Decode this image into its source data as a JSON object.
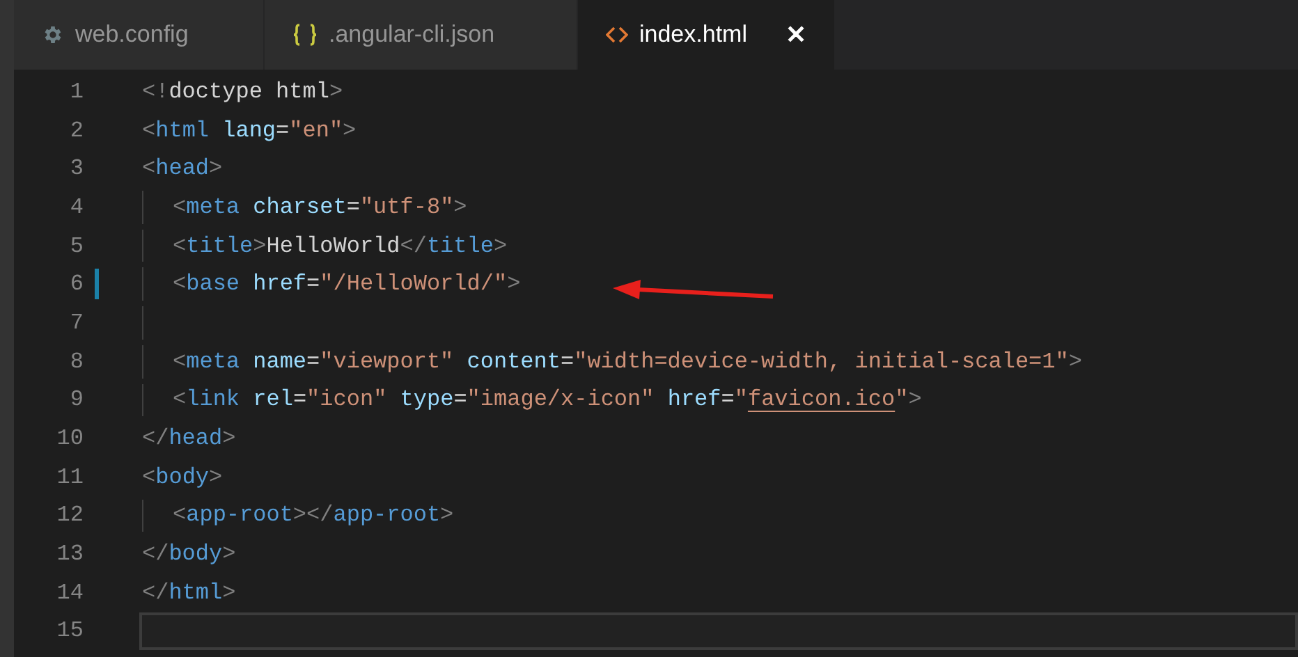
{
  "tabs": [
    {
      "label": "web.config",
      "selected": false
    },
    {
      "label": ".angular-cli.json",
      "selected": false
    },
    {
      "label": "index.html",
      "selected": true,
      "close": "✕"
    }
  ],
  "lines": [
    {
      "number": "1",
      "guide": false,
      "modified": false,
      "current": false,
      "text": "<!doctype html>"
    },
    {
      "number": "2",
      "guide": false,
      "modified": false,
      "current": false,
      "text": "<html lang=\"en\">"
    },
    {
      "number": "3",
      "guide": false,
      "modified": false,
      "current": false,
      "text": "<head>"
    },
    {
      "number": "4",
      "guide": true,
      "modified": false,
      "current": false,
      "text": "<meta charset=\"utf-8\">"
    },
    {
      "number": "5",
      "guide": true,
      "modified": false,
      "current": false,
      "text": "<title>HelloWorld</title>"
    },
    {
      "number": "6",
      "guide": true,
      "modified": true,
      "current": false,
      "text": "<base href=\"/HelloWorld/\">"
    },
    {
      "number": "7",
      "guide": true,
      "modified": false,
      "current": false
    },
    {
      "number": "8",
      "guide": true,
      "modified": false,
      "current": false,
      "text": "<meta name=\"viewport\" content=\"width=device-width, initial-scale=1\">"
    },
    {
      "number": "9",
      "guide": true,
      "modified": false,
      "current": false,
      "underlined_link": true,
      "text": "<link rel=\"icon\" type=\"image/x-icon\" href=\"favicon.ico\">"
    },
    {
      "number": "10",
      "guide": false,
      "modified": false,
      "current": false,
      "text": "</head>"
    },
    {
      "number": "11",
      "guide": false,
      "modified": false,
      "current": false,
      "text": "<body>"
    },
    {
      "number": "12",
      "guide": true,
      "modified": false,
      "current": false,
      "text": "<app-root></app-root>"
    },
    {
      "number": "13",
      "guide": false,
      "modified": false,
      "current": false,
      "text": "</body>"
    },
    {
      "number": "14",
      "guide": false,
      "modified": false,
      "current": false,
      "text": "</html>"
    },
    {
      "number": "15",
      "guide": false,
      "modified": false,
      "current": true
    }
  ]
}
